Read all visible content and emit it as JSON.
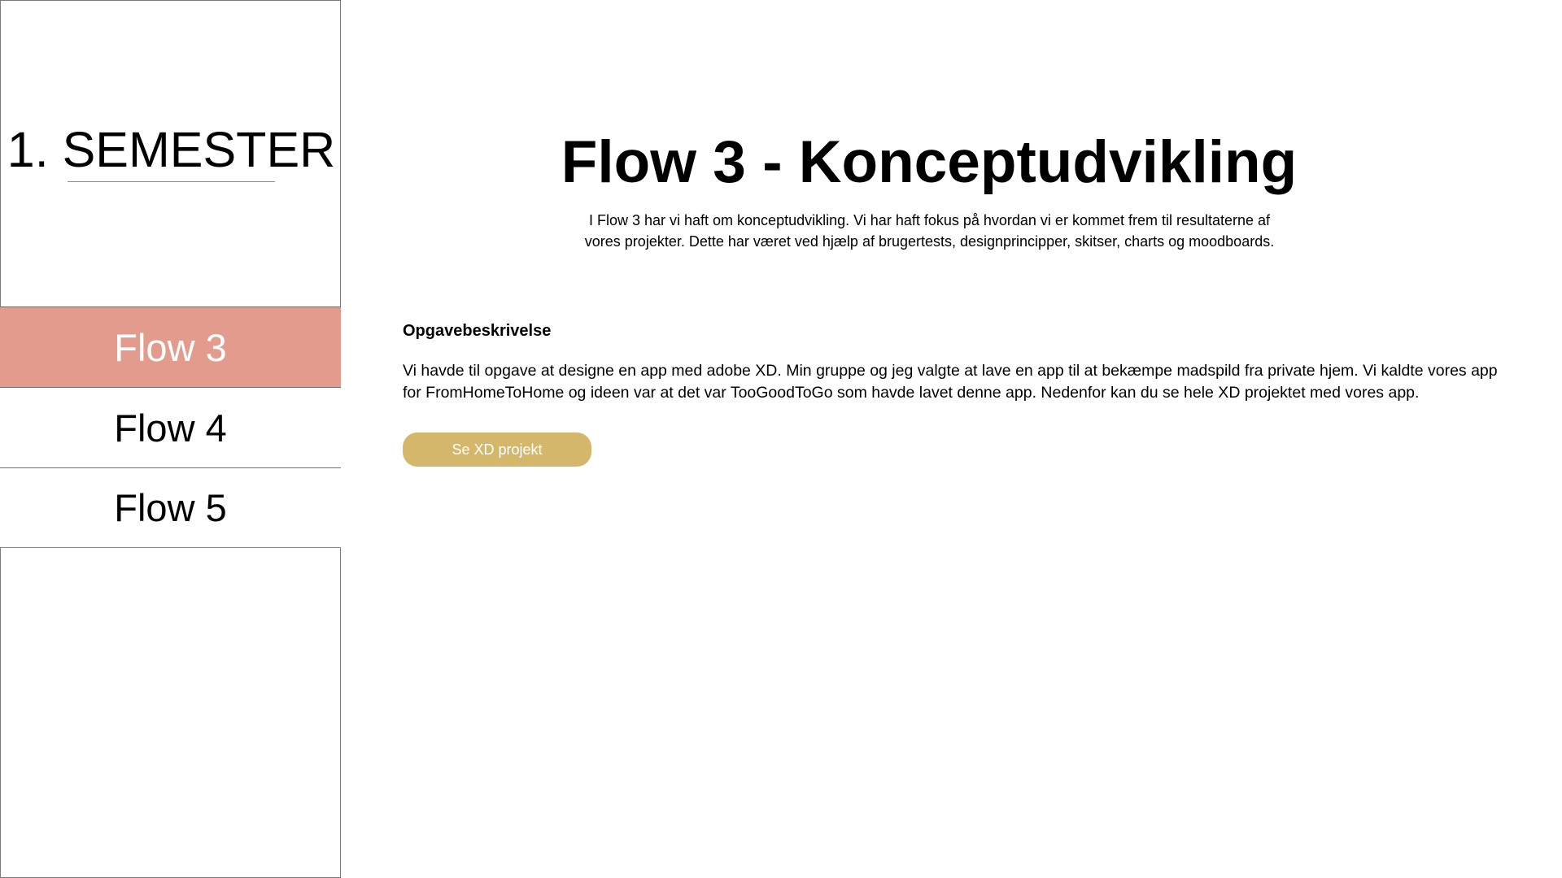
{
  "sidebar": {
    "brand_title": "1. SEMESTER",
    "items": [
      {
        "label": "Flow 3",
        "active": true
      },
      {
        "label": "Flow 4",
        "active": false
      },
      {
        "label": "Flow 5",
        "active": false
      }
    ]
  },
  "main": {
    "title": "Flow 3 - Konceptudvikling",
    "intro_line1": "I Flow 3 har vi haft om konceptudvikling. Vi har haft fokus på hvordan vi er kommet frem til resultaterne af",
    "intro_line2": "vores projekter. Dette har været ved hjælp af brugertests, designprincipper, skitser, charts og moodboards.",
    "section_heading": "Opgavebeskrivelse",
    "section_body_line1": "Vi havde til opgave at designe en app med adobe XD. Min gruppe og jeg valgte at lave en app til at bekæmpe madspild fra private hjem. Vi kaldte vores app",
    "section_body_line2": "for FromHomeToHome og ideen var at det var TooGoodToGo som havde lavet denne app. Nedenfor kan du se hele XD projektet med vores app.",
    "button_label": "Se XD projekt"
  },
  "colors": {
    "active_nav": "#e29b8d",
    "button": "#d4b76b"
  }
}
